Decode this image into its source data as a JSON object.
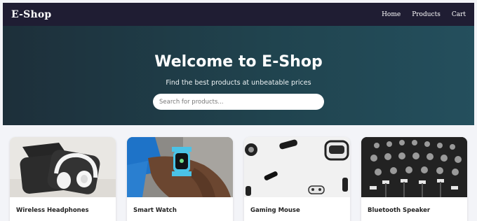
{
  "brand": "E-Shop",
  "nav": {
    "links": [
      "Home",
      "Products",
      "Cart"
    ]
  },
  "hero": {
    "title": "Welcome to E-Shop",
    "subtitle": "Find the best products at unbeatable prices",
    "search_placeholder": "Search for products..."
  },
  "products": [
    {
      "name": "Wireless Headphones",
      "image": "headphones-in-case"
    },
    {
      "name": "Smart Watch",
      "image": "smartwatch-on-wrist"
    },
    {
      "name": "Gaming Mouse",
      "image": "gaming-accessories-flatlay"
    },
    {
      "name": "Bluetooth Speaker",
      "image": "mixer-console"
    }
  ]
}
